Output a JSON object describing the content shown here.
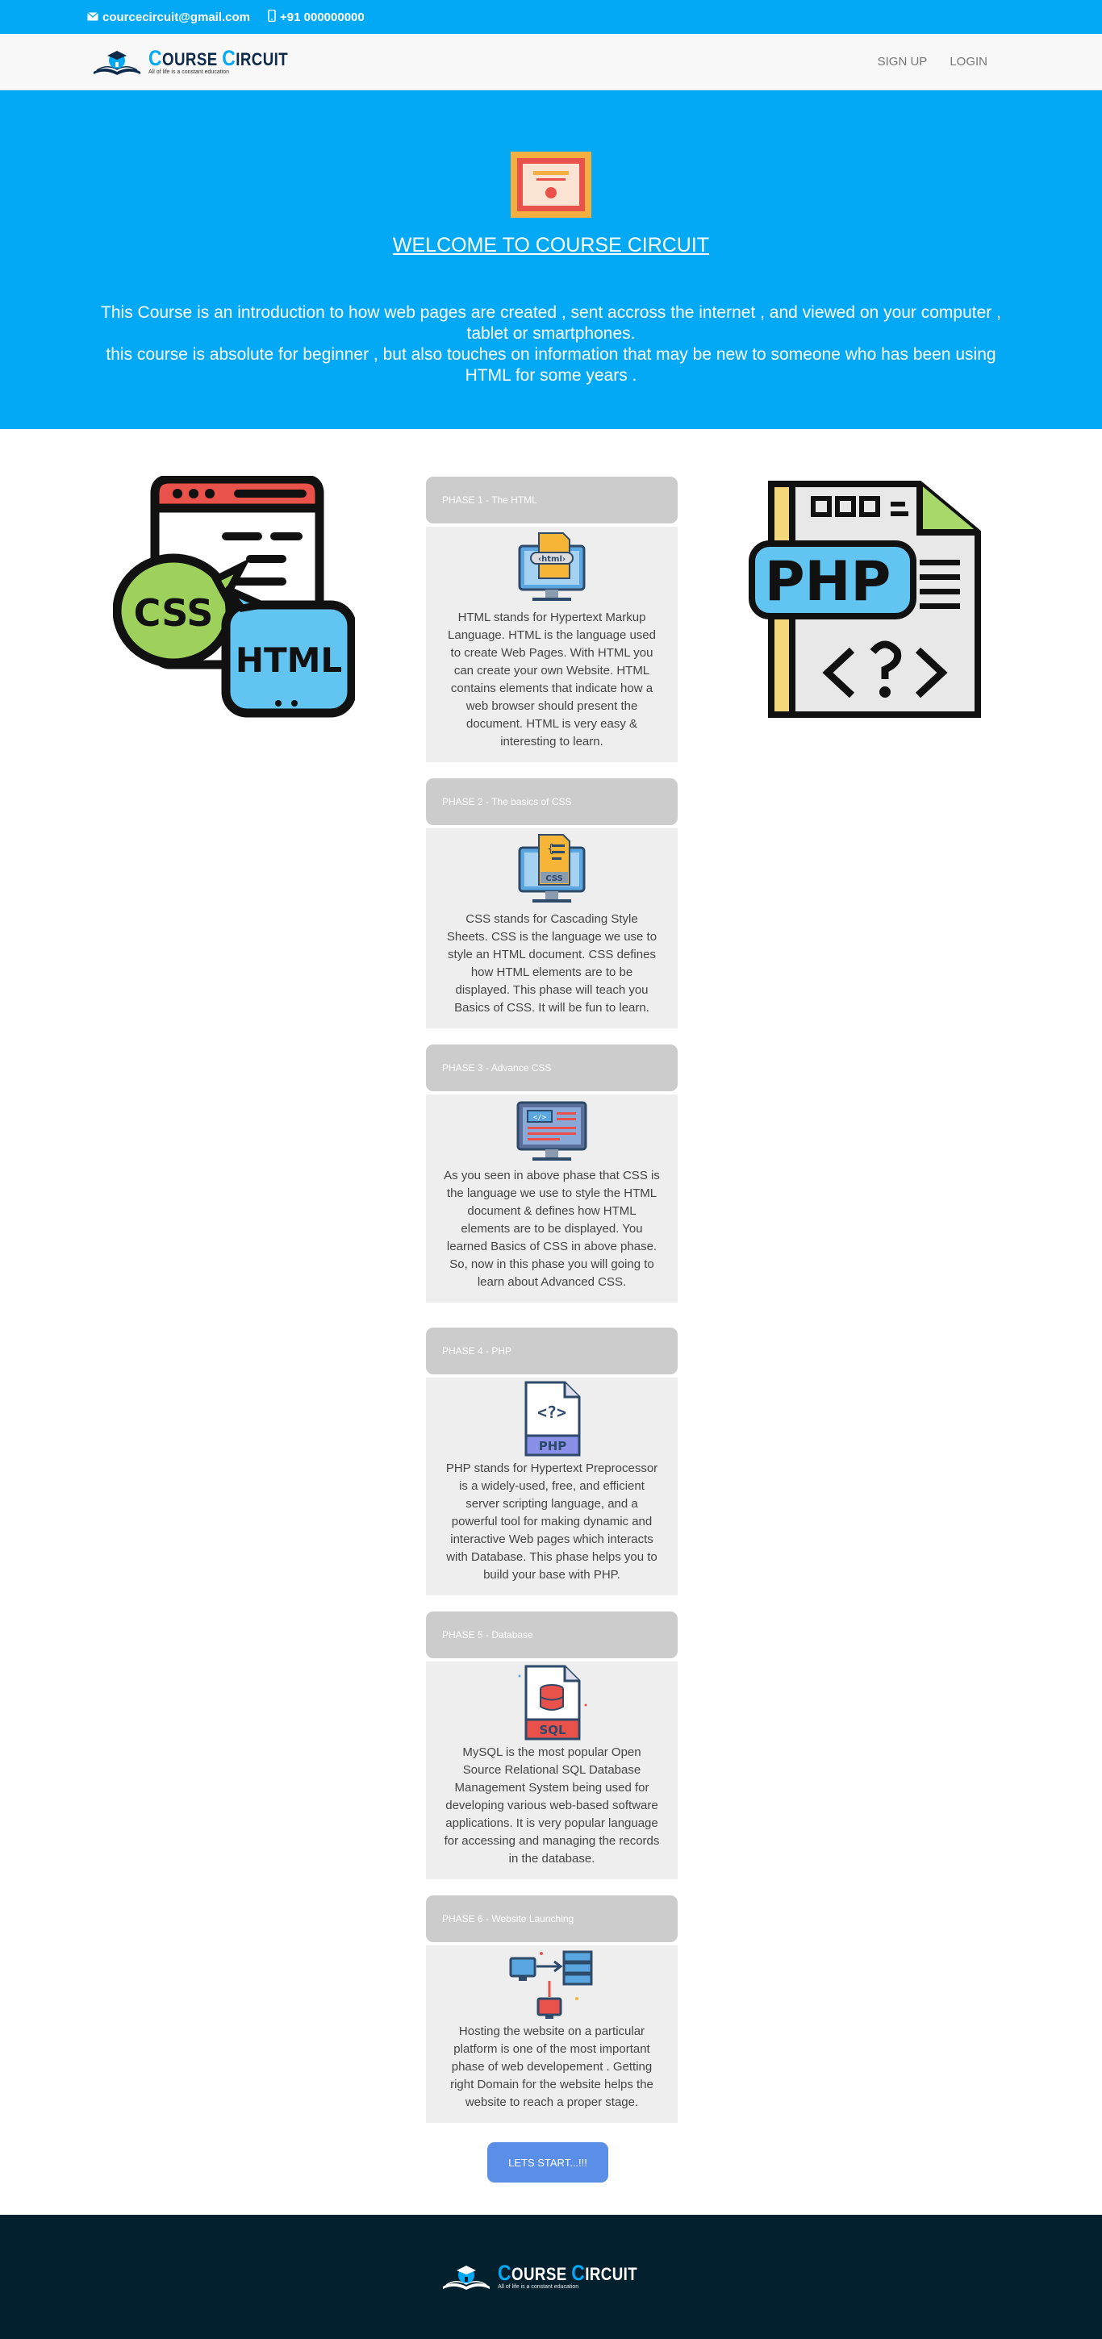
{
  "topbar": {
    "email": "courcecircuit@gmail.com",
    "phone": "+91 000000000",
    "email_icon": "envelope-icon",
    "phone_icon": "mobile-phone-icon"
  },
  "brand": {
    "title_c1": "C",
    "title_rest1": "OURSE ",
    "title_c2": "C",
    "title_rest2": "IRCUIT",
    "tagline": "All of life is a constant education",
    "accent": "#03a9f4",
    "navy": "#0d2a4a"
  },
  "nav": {
    "signup": "SIGN UP",
    "login": "LOGIN"
  },
  "hero": {
    "title": "WELCOME TO COURSE CIRCUIT",
    "line1": "This Course is an introduction to how web pages are created , sent accross the internet , and viewed on your computer , tablet or smartphones.",
    "line2": "this course is absolute for beginner , but also touches on information that may be new to someone who has been using HTML for some years .",
    "icon": "certificate-icon",
    "bg": "#03a9f4"
  },
  "side_images": {
    "left": "css-html-browser-icon",
    "right": "php-file-icon"
  },
  "phases": [
    {
      "title": "PHASE 1 - The HTML",
      "icon": "html-monitor-icon",
      "text": "HTML stands for Hypertext Markup Language. HTML is the language used to create Web Pages. With HTML you can create your own Website. HTML contains elements that indicate how a web browser should present the document. HTML is very easy & interesting to learn."
    },
    {
      "title": "PHASE 2 - The basics of CSS",
      "icon": "css-monitor-icon",
      "text": "CSS stands for Cascading Style Sheets. CSS is the language we use to style an HTML document. CSS defines how HTML elements are to be displayed. This phase will teach you Basics of CSS. It will be fun to learn."
    },
    {
      "title": "PHASE 3 - Advance CSS",
      "icon": "code-monitor-icon",
      "text": "As you seen in above phase that CSS is the language we use to style the HTML document & defines how HTML elements are to be displayed. You learned Basics of CSS in above phase. So, now in this phase you will going to learn about Advanced CSS."
    },
    {
      "title": "PHASE 4 - PHP",
      "icon": "php-document-icon",
      "text": "PHP stands for Hypertext Preprocessor is a widely-used, free, and efficient server scripting language, and a powerful tool for making dynamic and interactive Web pages which interacts with Database. This phase helps you to build your base with PHP."
    },
    {
      "title": "PHASE 5 - Database",
      "icon": "sql-document-icon",
      "text": "MySQL is the most popular Open Source Relational SQL Database Management System being used for developing various web-based software applications. It is very popular language for accessing and managing the records in the database."
    },
    {
      "title": "PHASE 6 - Website Launching",
      "icon": "server-network-icon",
      "text": "Hosting the website on a particular platform is one of the most important phase of web developement . Getting right Domain for the website helps the website to reach a proper stage."
    }
  ],
  "cta": {
    "label": "LETS START...!!!"
  },
  "footer": {
    "bg": "#03202f"
  }
}
